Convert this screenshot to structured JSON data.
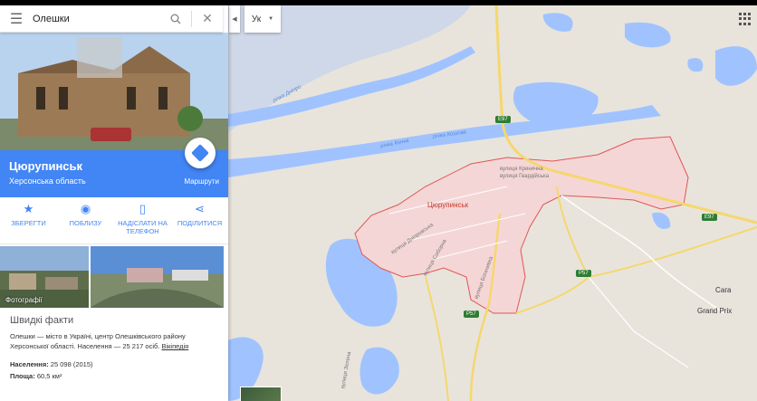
{
  "search": {
    "query": "Олешки"
  },
  "place": {
    "name": "Цюрупинськ",
    "region": "Херсонська область",
    "route_label": "Маршрути"
  },
  "actions": [
    {
      "label": "ЗБЕРЕГТИ",
      "icon": "star-icon"
    },
    {
      "label": "ПОБЛИЗУ",
      "icon": "nearby-pin-icon"
    },
    {
      "label": "НАДІСЛАТИ НА ТЕЛЕФОН",
      "icon": "send-to-phone-icon"
    },
    {
      "label": "ПОДІЛИТИСЯ",
      "icon": "share-icon"
    }
  ],
  "photos": {
    "label": "Фотографії"
  },
  "facts": {
    "heading": "Швидкі факти",
    "description": "Олешки — місто в Україні, центр Олешківського району Херсонської області. Населення — 25 217 осіб.",
    "source_link": "Вікіпедія",
    "population_label": "Населення:",
    "population_value": "25 098 (2015)",
    "area_label": "Площа:",
    "area_value": "60,5 км²"
  },
  "map": {
    "language": "Ук",
    "city_label": "Цюрупинськ",
    "place_labels": [
      "Сага",
      "Grand Prix"
    ],
    "road_shields": [
      "E97",
      "E97",
      "P57",
      "P57"
    ],
    "river_names": [
      "річка Конка",
      "річка Дніпро",
      "річка Кошова"
    ],
    "street_names": [
      "вулиця Кринична",
      "вулиця Гвардійська",
      "вулиця Дніпровська",
      "вулиця Соборна",
      "вулиця Богачивка",
      "вулиця Зелена"
    ],
    "colors": {
      "water": "#a0c3ff",
      "land": "#e8e4dc",
      "city": "#f5d6d6",
      "city_border": "#e05656",
      "major_road": "#f5d76e",
      "accent": "#4285f4"
    }
  }
}
